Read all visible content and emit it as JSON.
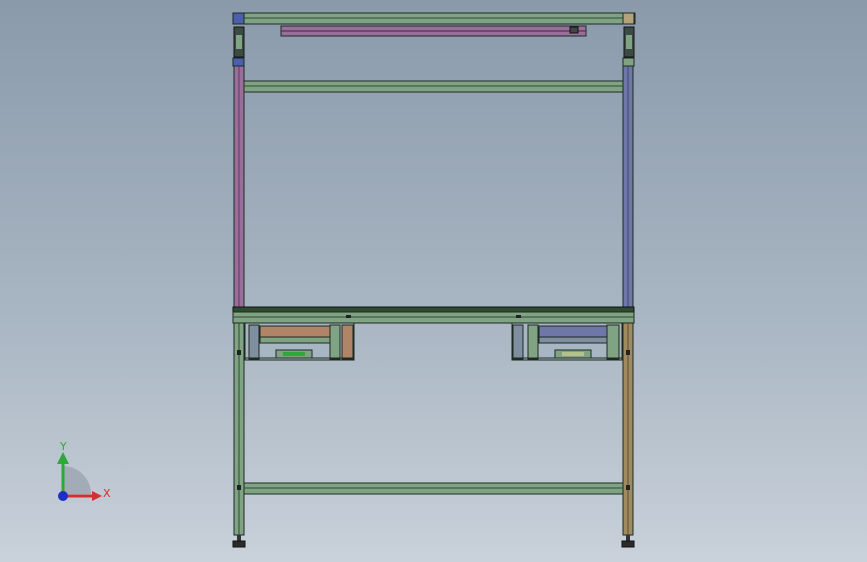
{
  "viewport": {
    "background_top": "#8a9aab",
    "background_bottom": "#c9d1da"
  },
  "model": {
    "description_kind": "aluminum-profile workbench frame (front view)",
    "colors": {
      "green_profile": "#7fa383",
      "green_dark": "#2f4a33",
      "purple_profile": "#9a6e9a",
      "blue_profile": "#6f77a8",
      "tan_profile": "#a08a5e",
      "brown_profile": "#b08466",
      "slate_profile": "#7f8fa0",
      "outline": "#1c2a22"
    }
  },
  "triad": {
    "x_label": "X",
    "y_label": "Y",
    "x_color": "#d23030",
    "y_color": "#2fa83a",
    "z_color": "#1e2fc8"
  }
}
